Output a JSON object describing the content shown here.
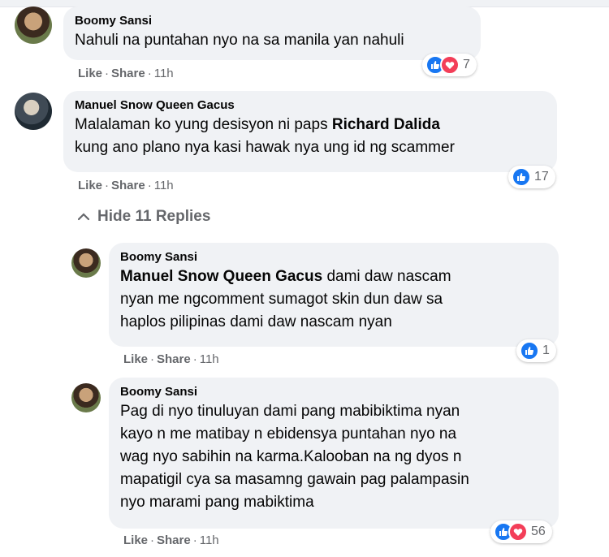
{
  "comments": [
    {
      "author": "Boomy Sansi",
      "text": "Nahuli na puntahan nyo na sa manila yan nahuli",
      "like": "Like",
      "share": "Share",
      "time": "11h",
      "reaction_count": "7"
    },
    {
      "author": "Manuel Snow Queen Gacus",
      "text_before": "Malalaman ko yung desisyon ni paps",
      "mention": "Richard Dalida",
      "text_after": "kung ano plano nya kasi hawak nya ung id ng scammer",
      "like": "Like",
      "share": "Share",
      "time": "11h",
      "reaction_count": "17"
    }
  ],
  "hide_replies": "Hide 11 Replies",
  "replies": [
    {
      "author": "Boomy Sansi",
      "mention": "Manuel Snow Queen Gacus",
      "text_l1": "dami daw nascam",
      "text_l2": "nyan me ngcomment sumagot skin dun daw sa",
      "text_l3": "haplos pilipinas dami daw nascam nyan",
      "like": "Like",
      "share": "Share",
      "time": "11h",
      "reaction_count": "1"
    },
    {
      "author": "Boomy Sansi",
      "text_l1": "Pag di nyo tinuluyan dami pang mabibiktima nyan",
      "text_l2": "kayo n me matibay n ebidensya puntahan nyo na",
      "text_l3": "wag nyo sabihin na karma.Kalooban na ng dyos n",
      "text_l4": "mapatigil cya sa masamng gawain pag palampasin",
      "text_l5": "nyo marami pang mabiktima",
      "like": "Like",
      "share": "Share",
      "time": "11h",
      "reaction_count": "56"
    }
  ],
  "separator": "·",
  "colors": {
    "like": "#1877f2",
    "love": "#f33e58",
    "bubble": "#f0f2f5",
    "meta": "#65676b"
  },
  "icons": [
    "like-reaction-icon",
    "love-reaction-icon",
    "chevron-up-icon"
  ]
}
